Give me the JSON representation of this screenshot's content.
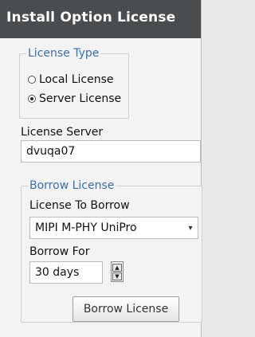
{
  "window": {
    "title": "Install Option License"
  },
  "license_type": {
    "legend": "License Type",
    "options": [
      {
        "label": "Local License",
        "selected": false
      },
      {
        "label": "Server License",
        "selected": true
      }
    ]
  },
  "license_server": {
    "label": "License Server",
    "value": "dvuqa07"
  },
  "borrow": {
    "legend": "Borrow License",
    "license_to_borrow_label": "License To Borrow",
    "license_to_borrow_value": "MIPI M-PHY UniPro",
    "borrow_for_label": "Borrow For",
    "borrow_for_value": "30 days",
    "button_label": "Borrow License"
  },
  "icons": {
    "select_arrow": "chevron-down-icon",
    "spinner_up": "triangle-up-icon",
    "spinner_down": "triangle-down-icon"
  }
}
